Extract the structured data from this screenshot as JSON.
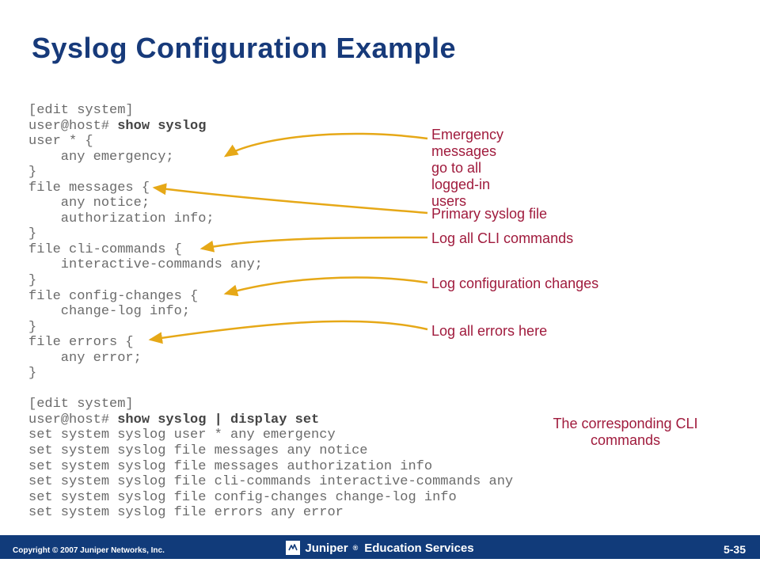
{
  "title": "Syslog Configuration Example",
  "code_block_1": {
    "l0": "[edit system]",
    "l1a": "user@host# ",
    "l1b": "show syslog",
    "l2": "user * {",
    "l3": "    any emergency;",
    "l4": "}",
    "l5": "file messages {",
    "l6": "    any notice;",
    "l7": "    authorization info;",
    "l8": "}",
    "l9": "file cli-commands {",
    "l10": "    interactive-commands any;",
    "l11": "}",
    "l12": "file config-changes {",
    "l13": "    change-log info;",
    "l14": "}",
    "l15": "file errors {",
    "l16": "    any error;",
    "l17": "}"
  },
  "code_block_2": {
    "l0": "[edit system]",
    "l1a": "user@host# ",
    "l1b": "show syslog | display set",
    "l2": "set system syslog user * any emergency",
    "l3": "set system syslog file messages any notice",
    "l4": "set system syslog file messages authorization info",
    "l5": "set system syslog file cli-commands interactive-commands any",
    "l6": "set system syslog file config-changes change-log info",
    "l7": "set system syslog file errors any error"
  },
  "annotations": {
    "a0": "Emergency messages go to all logged-in users",
    "a1": "Primary syslog file",
    "a2": "Log all CLI commands",
    "a3": "Log configuration changes",
    "a4": "Log all errors here",
    "a5": "The corresponding CLI commands"
  },
  "footer": {
    "copyright": "Copyright © 2007 Juniper Networks, Inc.",
    "brand": "Juniper",
    "edserv": "Education Services",
    "page": "5-35"
  },
  "arrow_color": "#e6a817"
}
